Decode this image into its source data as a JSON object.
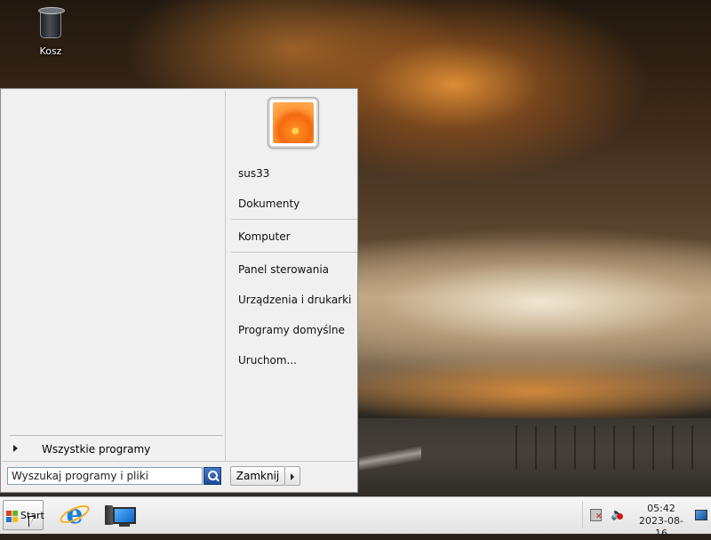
{
  "desktop": {
    "icons": [
      {
        "label": "Kosz",
        "icon": "recycle-bin-icon"
      }
    ]
  },
  "start_menu": {
    "all_programs_label": "Wszystkie programy",
    "search": {
      "placeholder": "Wyszukaj programy i pliki",
      "value": ""
    },
    "user_name": "sus33",
    "right_items": [
      {
        "label": "Dokumenty"
      },
      {
        "label": "Komputer"
      },
      {
        "label": "Panel sterowania"
      },
      {
        "label": "Urządzenia i drukarki"
      },
      {
        "label": "Programy domyślne"
      },
      {
        "label": "Uruchom..."
      }
    ],
    "shutdown_label": "Zamknij"
  },
  "taskbar": {
    "start_label": "Start",
    "pinned": [
      {
        "name": "Internet Explorer",
        "icon": "internet-explorer-icon"
      },
      {
        "name": "Komputer",
        "icon": "computer-icon"
      }
    ],
    "clock": {
      "time": "05:42",
      "date": "2023-08-16"
    }
  }
}
